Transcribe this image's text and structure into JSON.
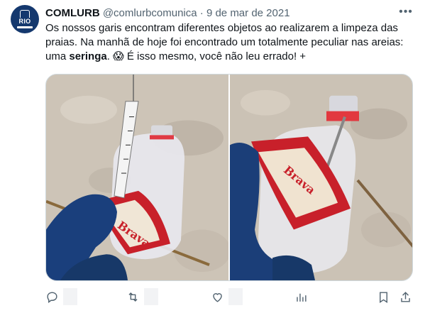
{
  "tweet": {
    "author_name": "COMLURB",
    "handle": "@comlurbcomunica",
    "separator": "·",
    "date": "9 de mar de 2021",
    "avatar_text": "RIO",
    "text_part1": "Os nossos garis encontram diferentes objetos ao realizarem a limpeza das praias. Na manhã de hoje foi encontrado um totalmente peculiar nas areias: uma ",
    "text_bold": "seringa",
    "text_part2": ". 😱  É isso mesmo, você não leu errado! +"
  },
  "media": {
    "bottle_label_text": "Brava"
  },
  "actions": {
    "reply_count": "",
    "retweet_count": "",
    "like_count": ""
  },
  "icons": [
    "more-icon",
    "reply-icon",
    "retweet-icon",
    "like-icon",
    "views-icon",
    "bookmark-icon",
    "share-icon"
  ]
}
